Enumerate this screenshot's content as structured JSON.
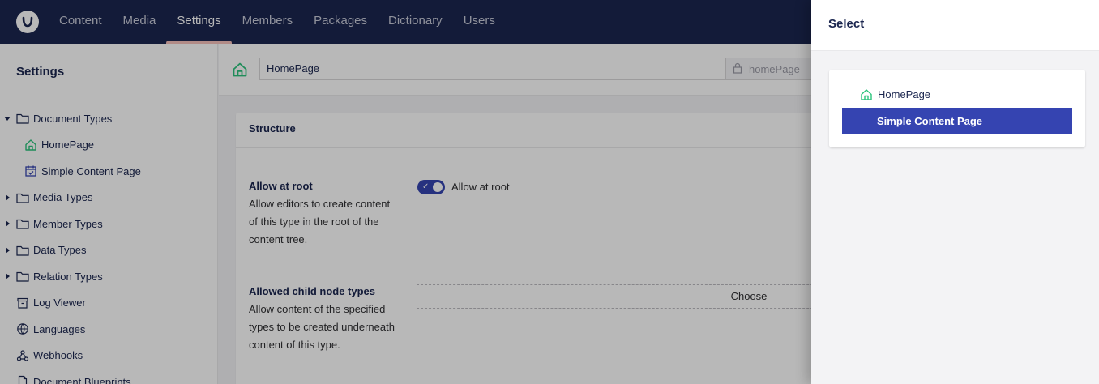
{
  "nav": {
    "items": [
      {
        "label": "Content"
      },
      {
        "label": "Media"
      },
      {
        "label": "Settings"
      },
      {
        "label": "Members"
      },
      {
        "label": "Packages"
      },
      {
        "label": "Dictionary"
      },
      {
        "label": "Users"
      }
    ],
    "active": "Settings"
  },
  "sidebar": {
    "title": "Settings",
    "items": [
      {
        "label": "Document Types",
        "icon": "folder-icon",
        "expanded": true
      },
      {
        "label": "HomePage",
        "icon": "home-icon"
      },
      {
        "label": "Simple Content Page",
        "icon": "calendar-check-icon"
      },
      {
        "label": "Media Types",
        "icon": "folder-icon"
      },
      {
        "label": "Member Types",
        "icon": "folder-icon"
      },
      {
        "label": "Data Types",
        "icon": "folder-icon"
      },
      {
        "label": "Relation Types",
        "icon": "folder-icon"
      },
      {
        "label": "Log Viewer",
        "icon": "archive-icon"
      },
      {
        "label": "Languages",
        "icon": "globe-icon"
      },
      {
        "label": "Webhooks",
        "icon": "webhook-icon"
      },
      {
        "label": "Document Blueprints",
        "icon": "document-icon"
      }
    ]
  },
  "editor": {
    "name_value": "HomePage",
    "alias_value": "homePage",
    "section_title": "Structure",
    "allow_root": {
      "label": "Allow at root",
      "description": "Allow editors to create content of this type in the root of the content tree.",
      "toggle_label": "Allow at root",
      "enabled": true
    },
    "allowed_children": {
      "label": "Allowed child node types",
      "description": "Allow content of the specified types to be created underneath content of this type.",
      "button_label": "Choose"
    }
  },
  "dialog": {
    "title": "Select",
    "options": [
      {
        "label": "HomePage",
        "icon": "home-icon",
        "selected": false
      },
      {
        "label": "Simple Content Page",
        "selected": true
      }
    ]
  },
  "colors": {
    "topbar": "#1b264f",
    "accent": "#3544b1",
    "home_icon": "#2bc37c",
    "active_underline": "#f5c1bc"
  }
}
